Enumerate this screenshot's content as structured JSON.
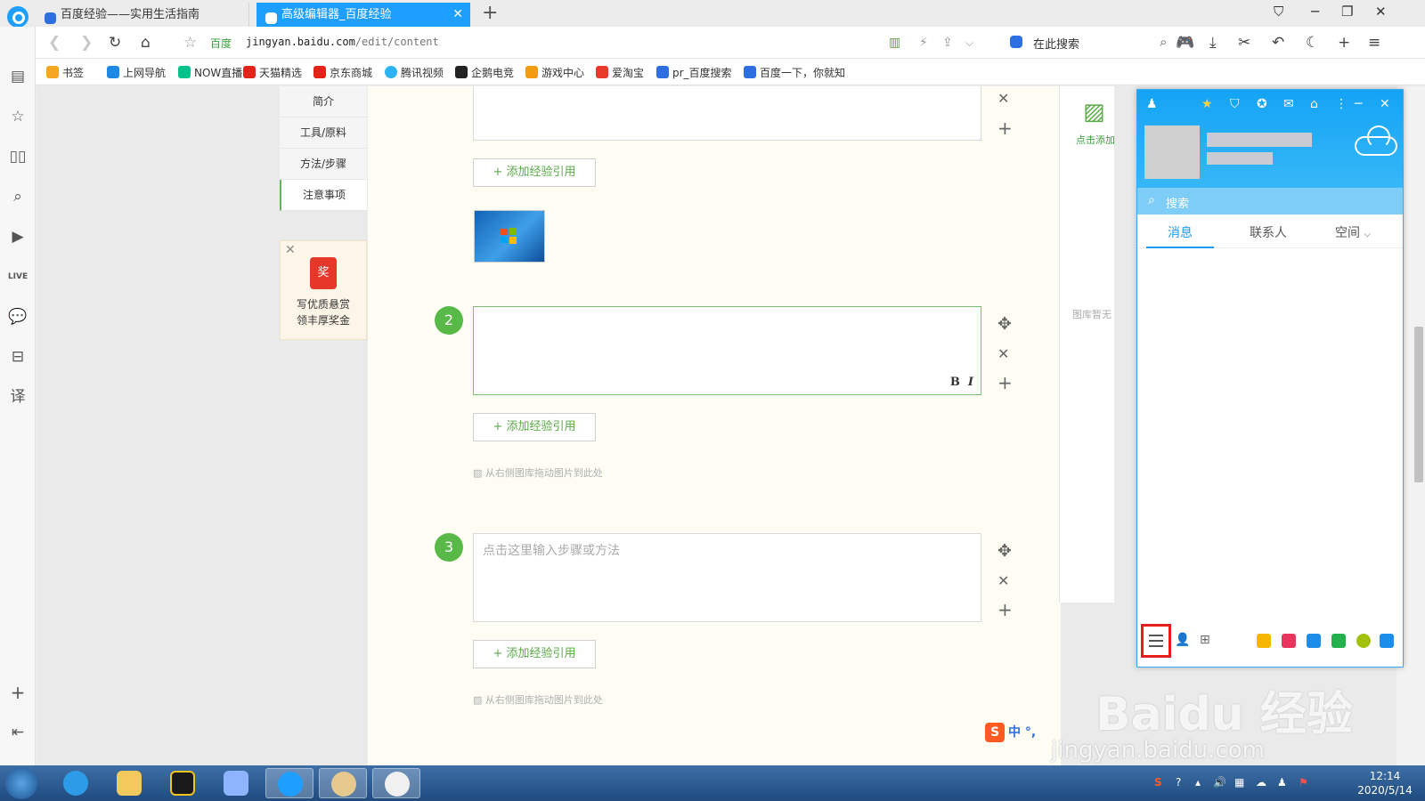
{
  "tabs": [
    {
      "title": "百度经验——实用生活指南",
      "active": false
    },
    {
      "title": "高级编辑器_百度经验",
      "active": true
    }
  ],
  "nav": {
    "site_label": "百度",
    "url_host": "jingyan.baidu.com",
    "url_path": "/edit/content",
    "search_label": "在此搜索"
  },
  "bookmarks": [
    {
      "label": "书签",
      "color": "#f5a623"
    },
    {
      "label": "上网导航",
      "color": "#1e88e5"
    },
    {
      "label": "NOW直播",
      "color": "#00c28a"
    },
    {
      "label": "天猫精选",
      "color": "#e2231a"
    },
    {
      "label": "京东商城",
      "color": "#e2231a"
    },
    {
      "label": "腾讯视频",
      "color": "#2bb3f3"
    },
    {
      "label": "企鹅电竞",
      "color": "#222222"
    },
    {
      "label": "游戏中心",
      "color": "#f39c12"
    },
    {
      "label": "爱淘宝",
      "color": "#e83a2b"
    },
    {
      "label": "pr_百度搜索",
      "color": "#2d6ee0"
    },
    {
      "label": "百度一下，你就知",
      "color": "#2d6ee0"
    }
  ],
  "left_nav": {
    "items": [
      "简介",
      "工具/原料",
      "方法/步骤",
      "注意事项"
    ],
    "active_index": 3
  },
  "ad": {
    "badge": "奖",
    "line1": "写优质悬赏",
    "line2": "领丰厚奖金"
  },
  "editor": {
    "add_ref_label": "+ 添加经验引用",
    "drop_hint": "从右侧图库拖动图片到此处",
    "step_placeholder": "点击这里输入步骤或方法",
    "steps": [
      {
        "number": "2"
      },
      {
        "number": "3"
      }
    ],
    "format_bold": "B",
    "format_italic": "I"
  },
  "gallery": {
    "add_label": "点击添加",
    "empty_label": "图库暂无"
  },
  "qq": {
    "search_label": "搜索",
    "tabs": [
      "消息",
      "联系人",
      "空间"
    ],
    "active_tab": 0
  },
  "ime": {
    "label": "中 °,"
  },
  "watermark": {
    "brand": "Baidu 经验",
    "url": "jingyan.baidu.com"
  },
  "clock": {
    "time": "12:14",
    "date": "2020/5/14"
  },
  "colors": {
    "accent_blue": "#1e9fff",
    "step_green": "#58b948",
    "ref_green": "#5aab47",
    "highlight_red": "#e81d1d"
  }
}
